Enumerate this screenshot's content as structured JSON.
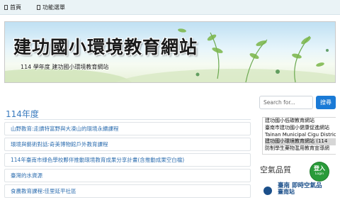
{
  "nav": {
    "home_label": "首頁",
    "menu_label": "功能選單"
  },
  "banner": {
    "title": "建功國小環境教育網站",
    "subtitle": "114 學年度 建功國小環境教育網站"
  },
  "main": {
    "section_title": "114年度",
    "items": [
      "山野教育:走讀特富野與大凍山的環境永續課程",
      "環境與藝術對話:奇美博物館戶外教育課程",
      "114年臺南市綠色學校夥伴推動環境教育成果分享計畫(含推動成果空白檔)",
      "臺灣的水資源",
      "食農教育課程:佳里延平社區"
    ]
  },
  "sidebar": {
    "search_placeholder": "Search for...",
    "search_button": "搜尋",
    "links": [
      "建功國小低碳教育網站",
      "臺南市建功國小健康促進網站",
      "Tainan Municipal Cigu District",
      "建功國小環境教育網站 (114",
      "防制學生藥物濫用教育宣導網"
    ],
    "active_link_index": 3,
    "air_quality_heading": "空氣品質",
    "login": {
      "main": "登入",
      "sub": "Login"
    },
    "aq_widget_title": "臺南 即時空氣品",
    "aq_widget_sub": "臺南站"
  },
  "colors": {
    "accent": "#1a7ad6",
    "section_title": "#3a7bbf",
    "login_green": "#2a9b3a"
  }
}
